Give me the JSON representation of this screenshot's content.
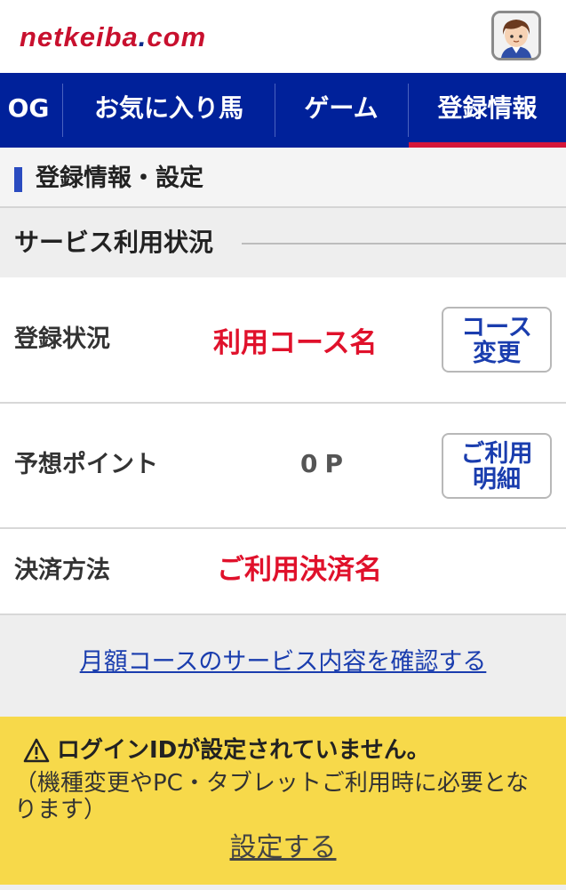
{
  "header": {
    "logo_main": "netkeiba",
    "logo_dot": ".",
    "logo_com": "com"
  },
  "nav": {
    "items": [
      {
        "label": "OG"
      },
      {
        "label": "お気に入り馬"
      },
      {
        "label": "ゲーム"
      },
      {
        "label": "登録情報"
      }
    ],
    "active_index": 3
  },
  "page": {
    "title": "登録情報・設定"
  },
  "section": {
    "title": "サービス利用状況"
  },
  "rows": [
    {
      "label": "登録状況",
      "value": "利用コース名",
      "button": [
        "コース",
        "変更"
      ]
    },
    {
      "label": "予想ポイント",
      "value": "0P",
      "button": [
        "ご利用",
        "明細"
      ]
    },
    {
      "label": "決済方法",
      "value": "ご利用決済名"
    }
  ],
  "links": {
    "monthly_course": "月額コースのサービス内容を確認する"
  },
  "warning": {
    "title": "ログインIDが設定されていません。",
    "body": "（機種変更やPC・タブレットご利用時に必要となります）",
    "action": "設定する"
  },
  "colors": {
    "nav_bg": "#00219a",
    "accent_red": "#e0112b",
    "link_blue": "#1a3dae",
    "warning_bg": "#f7d94a"
  }
}
